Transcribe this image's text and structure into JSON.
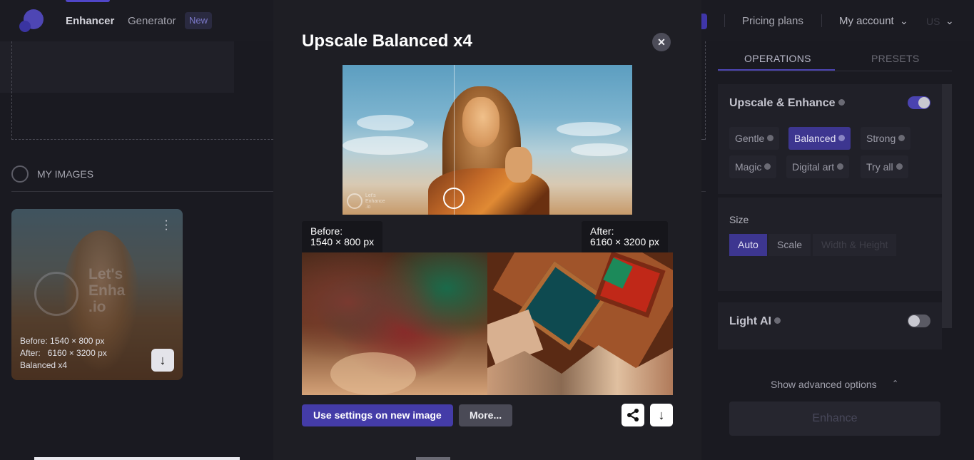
{
  "nav": {
    "enhancer": "Enhancer",
    "generator": "Generator",
    "new_badge": "New",
    "pricing": "Pricing plans",
    "account": "My account",
    "lang": "US"
  },
  "left": {
    "my_images": "MY IMAGES",
    "card": {
      "before": "Before: 1540 × 800 px",
      "after": "After:   6160 × 3200 px",
      "mode": "Balanced x4",
      "watermark": "Let's Enhance .io"
    }
  },
  "modal": {
    "title": "Upscale Balanced x4",
    "before_label": "Before:",
    "before_size": "1540 × 800 px",
    "after_label": "After:",
    "after_size": "6160 × 3200 px",
    "use_settings": "Use settings on new image",
    "more": "More...",
    "preview_watermark": "Let's Enhance .io"
  },
  "right": {
    "tabs": [
      "OPERATIONS",
      "PRESETS"
    ],
    "upscale_title": "Upscale & Enhance",
    "upscale_enabled": true,
    "modes": [
      "Gentle",
      "Balanced",
      "Strong",
      "Magic",
      "Digital art",
      "Try all"
    ],
    "selected_mode": "Balanced",
    "size_label": "Size",
    "size_options": [
      "Auto",
      "Scale",
      "Width & Height"
    ],
    "selected_size": "Auto",
    "light_ai": "Light AI",
    "light_ai_enabled": false,
    "advanced": "Show advanced options",
    "enhance": "Enhance"
  },
  "colors": {
    "accent": "#443ca8",
    "background": "#1a1a21",
    "modal": "#1e1e24"
  }
}
